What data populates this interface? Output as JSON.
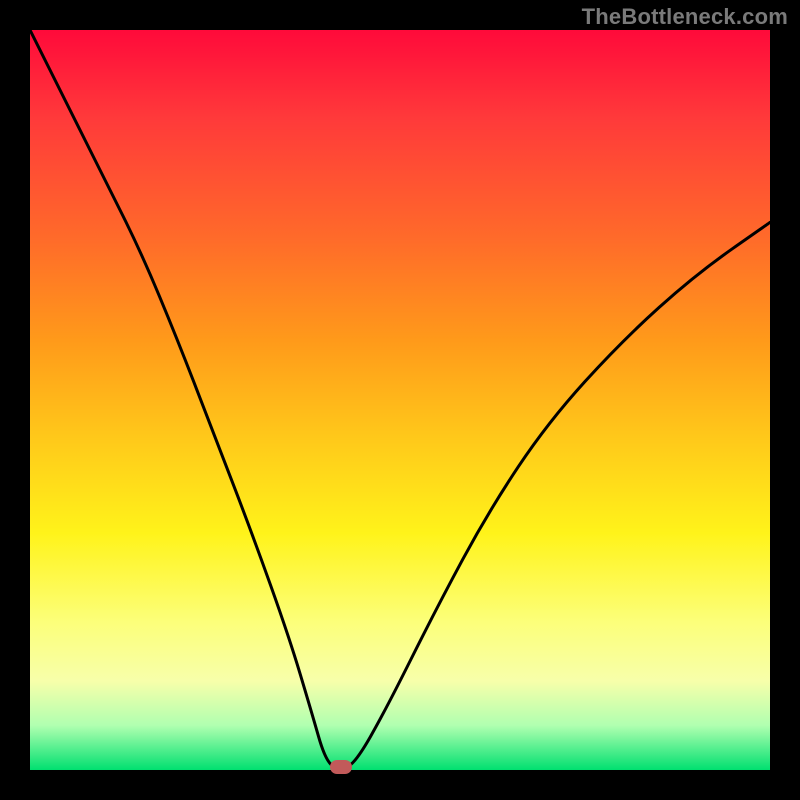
{
  "watermark": "TheBottleneck.com",
  "chart_data": {
    "type": "line",
    "title": "",
    "xlabel": "",
    "ylabel": "",
    "xlim": [
      0,
      100
    ],
    "ylim": [
      0,
      100
    ],
    "grid": false,
    "legend": false,
    "background": "red-to-green-vertical-gradient",
    "series": [
      {
        "name": "bottleneck-curve",
        "x": [
          0,
          5,
          10,
          15,
          20,
          25,
          30,
          35,
          38,
          40,
          42,
          44,
          48,
          55,
          62,
          70,
          80,
          90,
          100
        ],
        "y": [
          100,
          90,
          80,
          70,
          58,
          45,
          32,
          18,
          8,
          1,
          0,
          1,
          8,
          22,
          35,
          47,
          58,
          67,
          74
        ]
      }
    ],
    "marker": {
      "x": 42,
      "y": 0,
      "color": "#c25a5a"
    },
    "colors": {
      "gradient_top": "#ff0a3a",
      "gradient_bottom": "#00e070",
      "curve": "#000000",
      "frame": "#000000"
    }
  },
  "plot_geometry": {
    "inner_left": 30,
    "inner_top": 30,
    "inner_width": 740,
    "inner_height": 740
  }
}
